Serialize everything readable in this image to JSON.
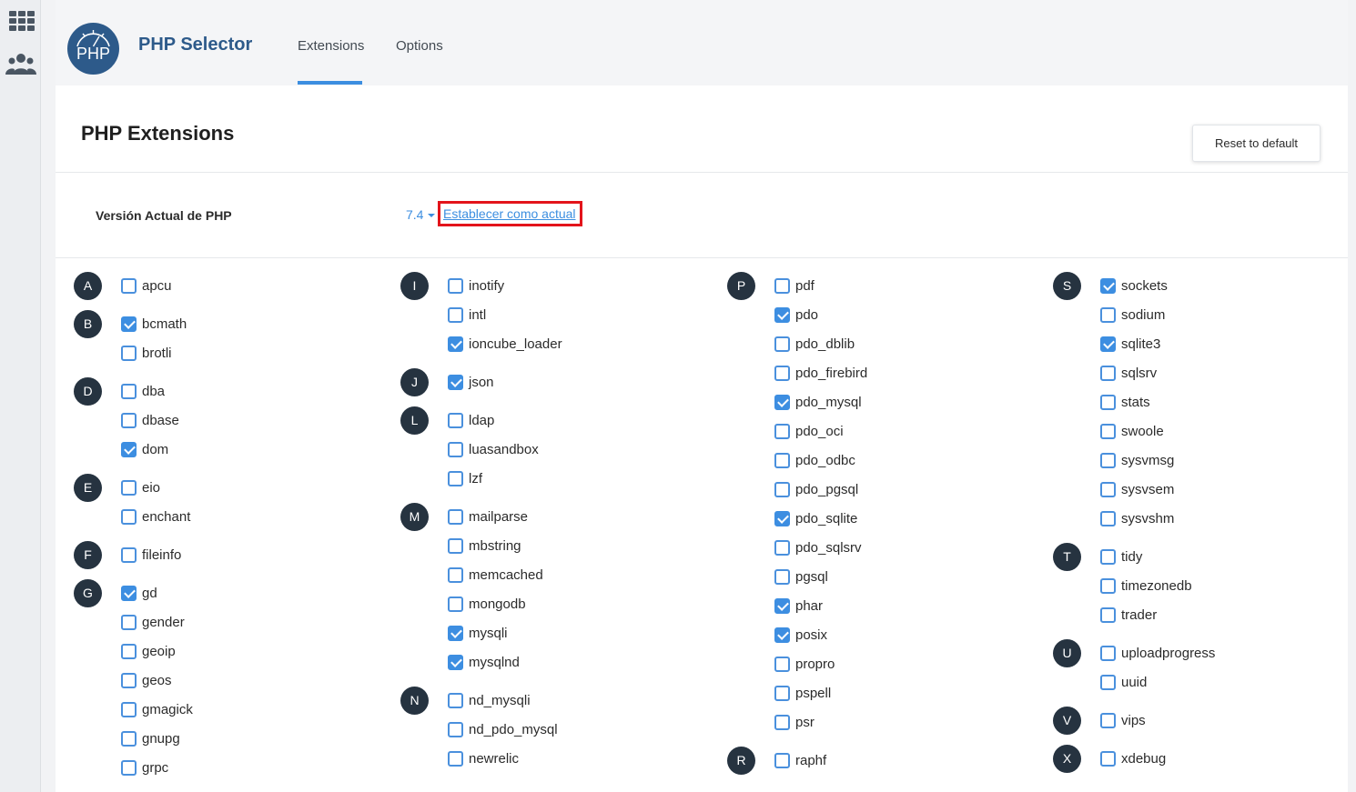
{
  "header": {
    "app_title": "PHP Selector",
    "logo_text": "PHP",
    "tabs": [
      {
        "label": "Extensions",
        "active": true
      },
      {
        "label": "Options",
        "active": false
      }
    ]
  },
  "sidebar_icons": [
    "grid-icon",
    "users-icon"
  ],
  "page": {
    "title": "PHP Extensions",
    "reset_label": "Reset to default",
    "version_label": "Versión Actual de PHP",
    "version_value": "7.4",
    "set_current_link": "Establecer como actual"
  },
  "colors": {
    "accent": "#3c8ee0",
    "title_blue": "#2d5a8a",
    "letter_badge": "#263340",
    "highlight_border": "#e3141b"
  },
  "columns": [
    {
      "groups": [
        {
          "letter": "A",
          "items": [
            {
              "name": "apcu",
              "checked": false
            }
          ]
        },
        {
          "letter": "B",
          "items": [
            {
              "name": "bcmath",
              "checked": true
            },
            {
              "name": "brotli",
              "checked": false
            }
          ]
        },
        {
          "letter": "D",
          "items": [
            {
              "name": "dba",
              "checked": false
            },
            {
              "name": "dbase",
              "checked": false
            },
            {
              "name": "dom",
              "checked": true
            }
          ]
        },
        {
          "letter": "E",
          "items": [
            {
              "name": "eio",
              "checked": false
            },
            {
              "name": "enchant",
              "checked": false
            }
          ]
        },
        {
          "letter": "F",
          "items": [
            {
              "name": "fileinfo",
              "checked": false
            }
          ]
        },
        {
          "letter": "G",
          "items": [
            {
              "name": "gd",
              "checked": true
            },
            {
              "name": "gender",
              "checked": false
            },
            {
              "name": "geoip",
              "checked": false
            },
            {
              "name": "geos",
              "checked": false
            },
            {
              "name": "gmagick",
              "checked": false
            },
            {
              "name": "gnupg",
              "checked": false
            },
            {
              "name": "grpc",
              "checked": false
            }
          ]
        }
      ]
    },
    {
      "groups": [
        {
          "letter": "I",
          "items": [
            {
              "name": "inotify",
              "checked": false
            },
            {
              "name": "intl",
              "checked": false
            },
            {
              "name": "ioncube_loader",
              "checked": true
            }
          ]
        },
        {
          "letter": "J",
          "items": [
            {
              "name": "json",
              "checked": true
            }
          ]
        },
        {
          "letter": "L",
          "items": [
            {
              "name": "ldap",
              "checked": false
            },
            {
              "name": "luasandbox",
              "checked": false
            },
            {
              "name": "lzf",
              "checked": false
            }
          ]
        },
        {
          "letter": "M",
          "items": [
            {
              "name": "mailparse",
              "checked": false
            },
            {
              "name": "mbstring",
              "checked": false
            },
            {
              "name": "memcached",
              "checked": false
            },
            {
              "name": "mongodb",
              "checked": false
            },
            {
              "name": "mysqli",
              "checked": true
            },
            {
              "name": "mysqlnd",
              "checked": true
            }
          ]
        },
        {
          "letter": "N",
          "items": [
            {
              "name": "nd_mysqli",
              "checked": false
            },
            {
              "name": "nd_pdo_mysql",
              "checked": false
            },
            {
              "name": "newrelic",
              "checked": false
            }
          ]
        }
      ]
    },
    {
      "groups": [
        {
          "letter": "P",
          "items": [
            {
              "name": "pdf",
              "checked": false
            },
            {
              "name": "pdo",
              "checked": true
            },
            {
              "name": "pdo_dblib",
              "checked": false
            },
            {
              "name": "pdo_firebird",
              "checked": false
            },
            {
              "name": "pdo_mysql",
              "checked": true
            },
            {
              "name": "pdo_oci",
              "checked": false
            },
            {
              "name": "pdo_odbc",
              "checked": false
            },
            {
              "name": "pdo_pgsql",
              "checked": false
            },
            {
              "name": "pdo_sqlite",
              "checked": true
            },
            {
              "name": "pdo_sqlsrv",
              "checked": false
            },
            {
              "name": "pgsql",
              "checked": false
            },
            {
              "name": "phar",
              "checked": true
            },
            {
              "name": "posix",
              "checked": true
            },
            {
              "name": "propro",
              "checked": false
            },
            {
              "name": "pspell",
              "checked": false
            },
            {
              "name": "psr",
              "checked": false
            }
          ]
        },
        {
          "letter": "R",
          "items": [
            {
              "name": "raphf",
              "checked": false
            }
          ]
        }
      ]
    },
    {
      "groups": [
        {
          "letter": "S",
          "items": [
            {
              "name": "sockets",
              "checked": true
            },
            {
              "name": "sodium",
              "checked": false
            },
            {
              "name": "sqlite3",
              "checked": true
            },
            {
              "name": "sqlsrv",
              "checked": false
            },
            {
              "name": "stats",
              "checked": false
            },
            {
              "name": "swoole",
              "checked": false
            },
            {
              "name": "sysvmsg",
              "checked": false
            },
            {
              "name": "sysvsem",
              "checked": false
            },
            {
              "name": "sysvshm",
              "checked": false
            }
          ]
        },
        {
          "letter": "T",
          "items": [
            {
              "name": "tidy",
              "checked": false
            },
            {
              "name": "timezonedb",
              "checked": false
            },
            {
              "name": "trader",
              "checked": false
            }
          ]
        },
        {
          "letter": "U",
          "items": [
            {
              "name": "uploadprogress",
              "checked": false
            },
            {
              "name": "uuid",
              "checked": false
            }
          ]
        },
        {
          "letter": "V",
          "items": [
            {
              "name": "vips",
              "checked": false
            }
          ]
        },
        {
          "letter": "X",
          "items": [
            {
              "name": "xdebug",
              "checked": false
            }
          ]
        }
      ]
    }
  ]
}
